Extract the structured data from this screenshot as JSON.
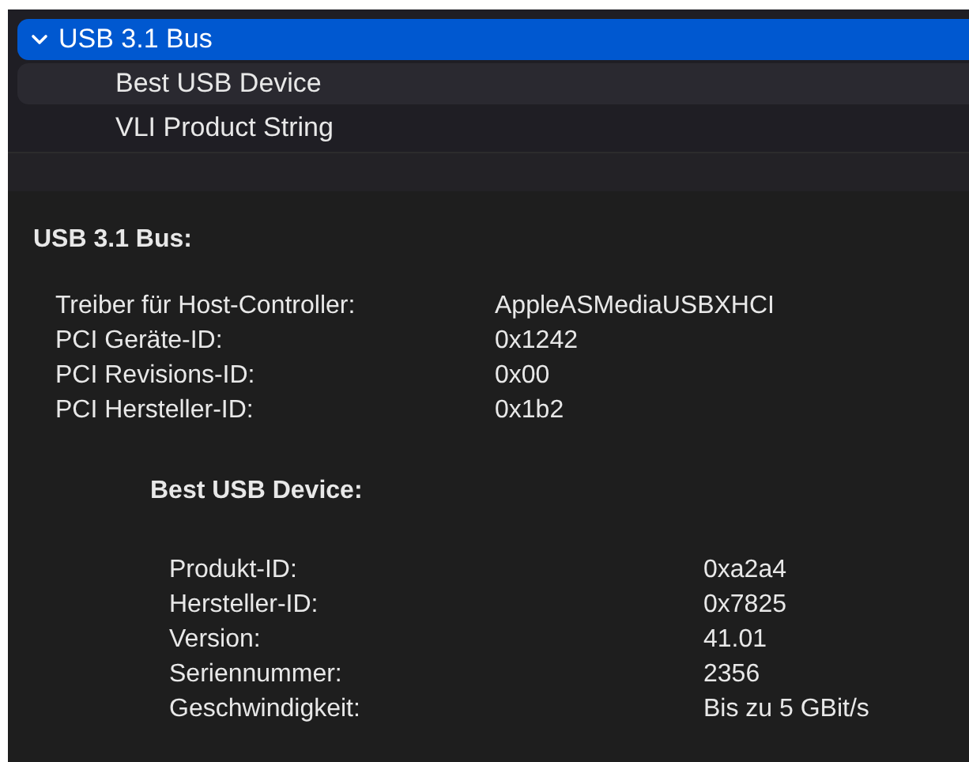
{
  "tree": [
    {
      "label": "USB 3.1 Bus",
      "selected": true,
      "expanded": true,
      "children": [
        {
          "label": "Best USB Device",
          "selected": false
        },
        {
          "label": "VLI Product String",
          "selected": false
        }
      ]
    }
  ],
  "details": {
    "title": "USB 3.1 Bus:",
    "fields": [
      {
        "label": "Treiber für Host-Controller:",
        "value": "AppleASMediaUSBXHCI"
      },
      {
        "label": "PCI Geräte-ID:",
        "value": "0x1242"
      },
      {
        "label": "PCI Revisions-ID:",
        "value": "0x00"
      },
      {
        "label": "PCI Hersteller-ID:",
        "value": "0x1b2"
      }
    ],
    "subsection": {
      "title": "Best USB Device:",
      "fields": [
        {
          "label": "Produkt-ID:",
          "value": "0xa2a4"
        },
        {
          "label": "Hersteller-ID:",
          "value": "0x7825"
        },
        {
          "label": "Version:",
          "value": "41.01"
        },
        {
          "label": "Seriennummer:",
          "value": "2356"
        },
        {
          "label": "Geschwindigkeit:",
          "value": "Bis zu 5 GBit/s"
        }
      ]
    }
  }
}
